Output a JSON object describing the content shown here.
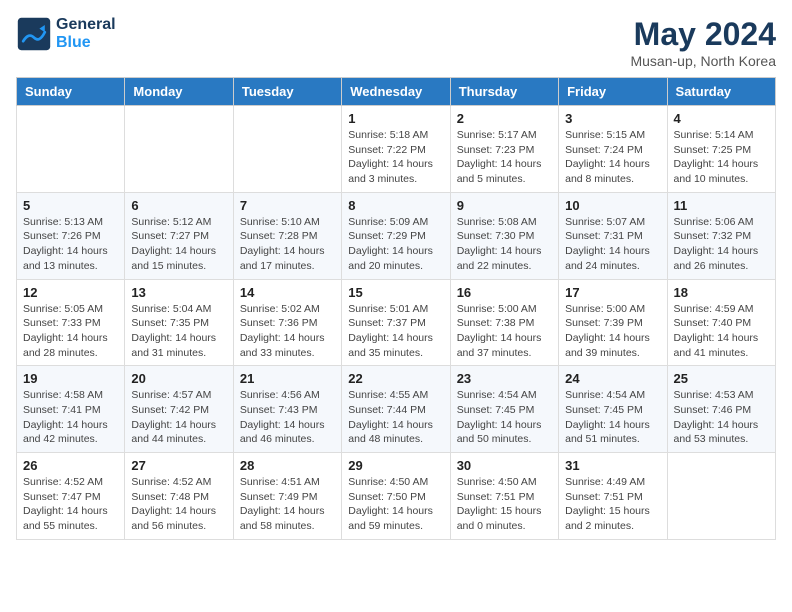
{
  "header": {
    "logo_line1": "General",
    "logo_line2": "Blue",
    "month": "May 2024",
    "location": "Musan-up, North Korea"
  },
  "weekdays": [
    "Sunday",
    "Monday",
    "Tuesday",
    "Wednesday",
    "Thursday",
    "Friday",
    "Saturday"
  ],
  "weeks": [
    [
      {
        "day": "",
        "info": ""
      },
      {
        "day": "",
        "info": ""
      },
      {
        "day": "",
        "info": ""
      },
      {
        "day": "1",
        "info": "Sunrise: 5:18 AM\nSunset: 7:22 PM\nDaylight: 14 hours and 3 minutes."
      },
      {
        "day": "2",
        "info": "Sunrise: 5:17 AM\nSunset: 7:23 PM\nDaylight: 14 hours and 5 minutes."
      },
      {
        "day": "3",
        "info": "Sunrise: 5:15 AM\nSunset: 7:24 PM\nDaylight: 14 hours and 8 minutes."
      },
      {
        "day": "4",
        "info": "Sunrise: 5:14 AM\nSunset: 7:25 PM\nDaylight: 14 hours and 10 minutes."
      }
    ],
    [
      {
        "day": "5",
        "info": "Sunrise: 5:13 AM\nSunset: 7:26 PM\nDaylight: 14 hours and 13 minutes."
      },
      {
        "day": "6",
        "info": "Sunrise: 5:12 AM\nSunset: 7:27 PM\nDaylight: 14 hours and 15 minutes."
      },
      {
        "day": "7",
        "info": "Sunrise: 5:10 AM\nSunset: 7:28 PM\nDaylight: 14 hours and 17 minutes."
      },
      {
        "day": "8",
        "info": "Sunrise: 5:09 AM\nSunset: 7:29 PM\nDaylight: 14 hours and 20 minutes."
      },
      {
        "day": "9",
        "info": "Sunrise: 5:08 AM\nSunset: 7:30 PM\nDaylight: 14 hours and 22 minutes."
      },
      {
        "day": "10",
        "info": "Sunrise: 5:07 AM\nSunset: 7:31 PM\nDaylight: 14 hours and 24 minutes."
      },
      {
        "day": "11",
        "info": "Sunrise: 5:06 AM\nSunset: 7:32 PM\nDaylight: 14 hours and 26 minutes."
      }
    ],
    [
      {
        "day": "12",
        "info": "Sunrise: 5:05 AM\nSunset: 7:33 PM\nDaylight: 14 hours and 28 minutes."
      },
      {
        "day": "13",
        "info": "Sunrise: 5:04 AM\nSunset: 7:35 PM\nDaylight: 14 hours and 31 minutes."
      },
      {
        "day": "14",
        "info": "Sunrise: 5:02 AM\nSunset: 7:36 PM\nDaylight: 14 hours and 33 minutes."
      },
      {
        "day": "15",
        "info": "Sunrise: 5:01 AM\nSunset: 7:37 PM\nDaylight: 14 hours and 35 minutes."
      },
      {
        "day": "16",
        "info": "Sunrise: 5:00 AM\nSunset: 7:38 PM\nDaylight: 14 hours and 37 minutes."
      },
      {
        "day": "17",
        "info": "Sunrise: 5:00 AM\nSunset: 7:39 PM\nDaylight: 14 hours and 39 minutes."
      },
      {
        "day": "18",
        "info": "Sunrise: 4:59 AM\nSunset: 7:40 PM\nDaylight: 14 hours and 41 minutes."
      }
    ],
    [
      {
        "day": "19",
        "info": "Sunrise: 4:58 AM\nSunset: 7:41 PM\nDaylight: 14 hours and 42 minutes."
      },
      {
        "day": "20",
        "info": "Sunrise: 4:57 AM\nSunset: 7:42 PM\nDaylight: 14 hours and 44 minutes."
      },
      {
        "day": "21",
        "info": "Sunrise: 4:56 AM\nSunset: 7:43 PM\nDaylight: 14 hours and 46 minutes."
      },
      {
        "day": "22",
        "info": "Sunrise: 4:55 AM\nSunset: 7:44 PM\nDaylight: 14 hours and 48 minutes."
      },
      {
        "day": "23",
        "info": "Sunrise: 4:54 AM\nSunset: 7:45 PM\nDaylight: 14 hours and 50 minutes."
      },
      {
        "day": "24",
        "info": "Sunrise: 4:54 AM\nSunset: 7:45 PM\nDaylight: 14 hours and 51 minutes."
      },
      {
        "day": "25",
        "info": "Sunrise: 4:53 AM\nSunset: 7:46 PM\nDaylight: 14 hours and 53 minutes."
      }
    ],
    [
      {
        "day": "26",
        "info": "Sunrise: 4:52 AM\nSunset: 7:47 PM\nDaylight: 14 hours and 55 minutes."
      },
      {
        "day": "27",
        "info": "Sunrise: 4:52 AM\nSunset: 7:48 PM\nDaylight: 14 hours and 56 minutes."
      },
      {
        "day": "28",
        "info": "Sunrise: 4:51 AM\nSunset: 7:49 PM\nDaylight: 14 hours and 58 minutes."
      },
      {
        "day": "29",
        "info": "Sunrise: 4:50 AM\nSunset: 7:50 PM\nDaylight: 14 hours and 59 minutes."
      },
      {
        "day": "30",
        "info": "Sunrise: 4:50 AM\nSunset: 7:51 PM\nDaylight: 15 hours and 0 minutes."
      },
      {
        "day": "31",
        "info": "Sunrise: 4:49 AM\nSunset: 7:51 PM\nDaylight: 15 hours and 2 minutes."
      },
      {
        "day": "",
        "info": ""
      }
    ]
  ]
}
